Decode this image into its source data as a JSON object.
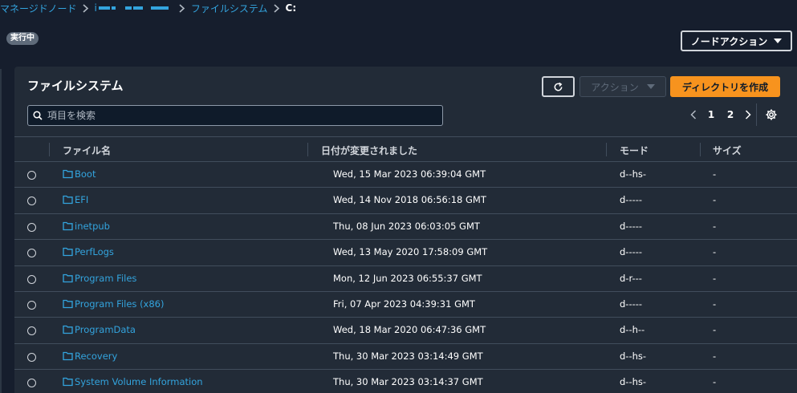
{
  "breadcrumb": {
    "managed_nodes": "マネージドノード",
    "node_id_prefix": "i",
    "file_system": "ファイルシステム",
    "current": "C:"
  },
  "status": {
    "badge": "実行中"
  },
  "node_action": {
    "label": "ノードアクション"
  },
  "panel": {
    "title": "ファイルシステム",
    "action_label": "アクション",
    "create_dir_label": "ディレクトリを作成",
    "search_placeholder": "項目を検索"
  },
  "pagination": {
    "pages": [
      "1",
      "2"
    ],
    "current": "1"
  },
  "table": {
    "columns": {
      "name": "ファイル名",
      "date": "日付が変更されました",
      "mode": "モード",
      "size": "サイズ"
    },
    "rows": [
      {
        "name": "Boot",
        "date": "Wed, 15 Mar 2023 06:39:04 GMT",
        "mode": "d--hs-",
        "size": "-"
      },
      {
        "name": "EFI",
        "date": "Wed, 14 Nov 2018 06:56:18 GMT",
        "mode": "d-----",
        "size": "-"
      },
      {
        "name": "inetpub",
        "date": "Thu, 08 Jun 2023 06:03:05 GMT",
        "mode": "d-----",
        "size": "-"
      },
      {
        "name": "PerfLogs",
        "date": "Wed, 13 May 2020 17:58:09 GMT",
        "mode": "d-----",
        "size": "-"
      },
      {
        "name": "Program Files",
        "date": "Mon, 12 Jun 2023 06:55:37 GMT",
        "mode": "d-r---",
        "size": "-"
      },
      {
        "name": "Program Files (x86)",
        "date": "Fri, 07 Apr 2023 04:39:31 GMT",
        "mode": "d-----",
        "size": "-"
      },
      {
        "name": "ProgramData",
        "date": "Wed, 18 Mar 2020 06:47:36 GMT",
        "mode": "d--h--",
        "size": "-"
      },
      {
        "name": "Recovery",
        "date": "Thu, 30 Mar 2023 03:14:49 GMT",
        "mode": "d--hs-",
        "size": "-"
      },
      {
        "name": "System Volume Information",
        "date": "Thu, 30 Mar 2023 03:14:37 GMT",
        "mode": "d--hs-",
        "size": "-"
      }
    ]
  },
  "colors": {
    "link": "#33a4de",
    "primary_button": "#f7931e",
    "background": "#161e2d",
    "panel": "#222b37"
  },
  "icons": [
    "chevron-right-icon",
    "refresh-icon",
    "caret-down-icon",
    "search-icon",
    "chevron-left-icon",
    "settings-gear-icon",
    "folder-icon"
  ]
}
